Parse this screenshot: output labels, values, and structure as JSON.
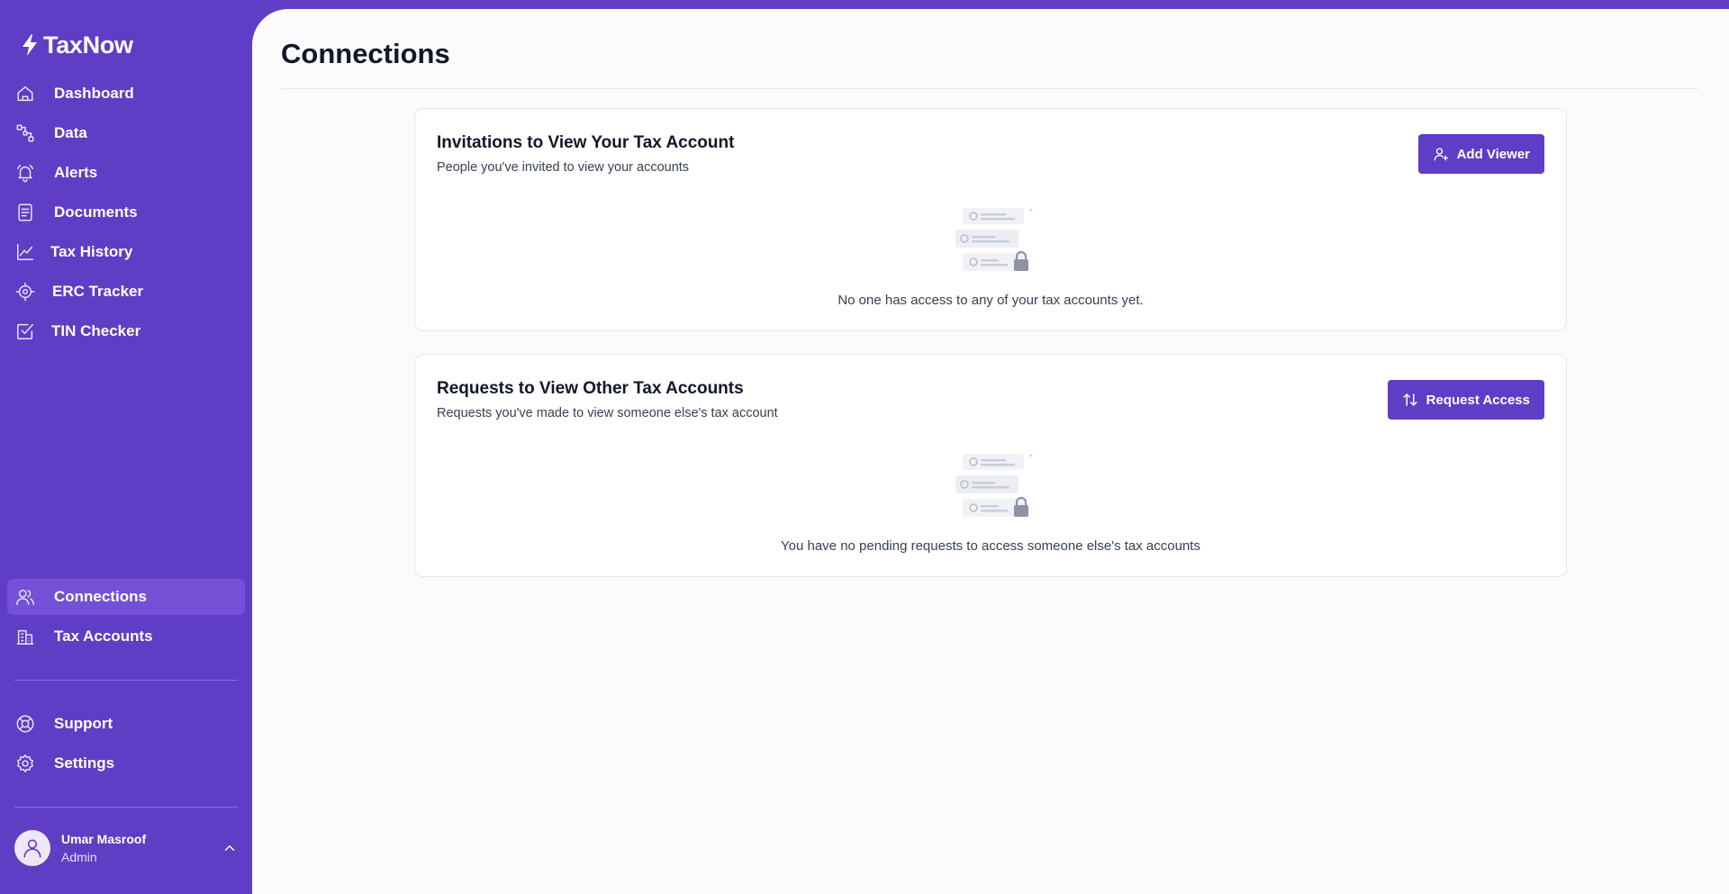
{
  "app": {
    "name": "TaxNow",
    "brand_color": "#5f3dc4"
  },
  "sidebar": {
    "items": [
      {
        "label": "Dashboard",
        "icon": "home-icon"
      },
      {
        "label": "Data",
        "icon": "data-nodes-icon"
      },
      {
        "label": "Alerts",
        "icon": "bell-icon"
      },
      {
        "label": "Documents",
        "icon": "document-icon"
      },
      {
        "label": "Tax History",
        "icon": "line-chart-icon"
      },
      {
        "label": "ERC Tracker",
        "icon": "target-icon"
      },
      {
        "label": "TIN Checker",
        "icon": "checkbox-icon"
      }
    ],
    "secondary_items": [
      {
        "label": "Connections",
        "icon": "users-icon",
        "active": true
      },
      {
        "label": "Tax Accounts",
        "icon": "buildings-icon"
      }
    ],
    "footer_items": [
      {
        "label": "Support",
        "icon": "lifebuoy-icon"
      },
      {
        "label": "Settings",
        "icon": "gear-icon"
      }
    ],
    "user": {
      "name": "Umar Masroof",
      "role": "Admin"
    }
  },
  "main": {
    "title": "Connections",
    "cards": [
      {
        "title": "Invitations to View Your Tax Account",
        "subtitle": "People you've invited to view your accounts",
        "button_label": "Add Viewer",
        "button_icon": "user-plus-icon",
        "empty_text": "No one has access to any of your tax accounts yet."
      },
      {
        "title": "Requests to View Other Tax Accounts",
        "subtitle": "Requests you've made to view someone else's tax account",
        "button_label": "Request Access",
        "button_icon": "arrows-up-down-icon",
        "empty_text": "You have no pending requests to access someone else's tax accounts"
      }
    ]
  }
}
